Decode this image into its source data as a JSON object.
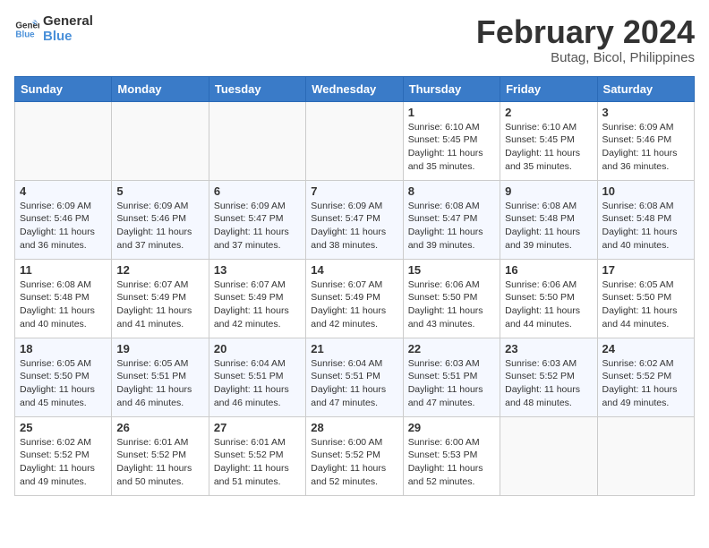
{
  "logo": {
    "text_general": "General",
    "text_blue": "Blue"
  },
  "header": {
    "title": "February 2024",
    "subtitle": "Butag, Bicol, Philippines"
  },
  "weekdays": [
    "Sunday",
    "Monday",
    "Tuesday",
    "Wednesday",
    "Thursday",
    "Friday",
    "Saturday"
  ],
  "weeks": [
    [
      {
        "day": "",
        "info": ""
      },
      {
        "day": "",
        "info": ""
      },
      {
        "day": "",
        "info": ""
      },
      {
        "day": "",
        "info": ""
      },
      {
        "day": "1",
        "info": "Sunrise: 6:10 AM\nSunset: 5:45 PM\nDaylight: 11 hours\nand 35 minutes."
      },
      {
        "day": "2",
        "info": "Sunrise: 6:10 AM\nSunset: 5:45 PM\nDaylight: 11 hours\nand 35 minutes."
      },
      {
        "day": "3",
        "info": "Sunrise: 6:09 AM\nSunset: 5:46 PM\nDaylight: 11 hours\nand 36 minutes."
      }
    ],
    [
      {
        "day": "4",
        "info": "Sunrise: 6:09 AM\nSunset: 5:46 PM\nDaylight: 11 hours\nand 36 minutes."
      },
      {
        "day": "5",
        "info": "Sunrise: 6:09 AM\nSunset: 5:46 PM\nDaylight: 11 hours\nand 37 minutes."
      },
      {
        "day": "6",
        "info": "Sunrise: 6:09 AM\nSunset: 5:47 PM\nDaylight: 11 hours\nand 37 minutes."
      },
      {
        "day": "7",
        "info": "Sunrise: 6:09 AM\nSunset: 5:47 PM\nDaylight: 11 hours\nand 38 minutes."
      },
      {
        "day": "8",
        "info": "Sunrise: 6:08 AM\nSunset: 5:47 PM\nDaylight: 11 hours\nand 39 minutes."
      },
      {
        "day": "9",
        "info": "Sunrise: 6:08 AM\nSunset: 5:48 PM\nDaylight: 11 hours\nand 39 minutes."
      },
      {
        "day": "10",
        "info": "Sunrise: 6:08 AM\nSunset: 5:48 PM\nDaylight: 11 hours\nand 40 minutes."
      }
    ],
    [
      {
        "day": "11",
        "info": "Sunrise: 6:08 AM\nSunset: 5:48 PM\nDaylight: 11 hours\nand 40 minutes."
      },
      {
        "day": "12",
        "info": "Sunrise: 6:07 AM\nSunset: 5:49 PM\nDaylight: 11 hours\nand 41 minutes."
      },
      {
        "day": "13",
        "info": "Sunrise: 6:07 AM\nSunset: 5:49 PM\nDaylight: 11 hours\nand 42 minutes."
      },
      {
        "day": "14",
        "info": "Sunrise: 6:07 AM\nSunset: 5:49 PM\nDaylight: 11 hours\nand 42 minutes."
      },
      {
        "day": "15",
        "info": "Sunrise: 6:06 AM\nSunset: 5:50 PM\nDaylight: 11 hours\nand 43 minutes."
      },
      {
        "day": "16",
        "info": "Sunrise: 6:06 AM\nSunset: 5:50 PM\nDaylight: 11 hours\nand 44 minutes."
      },
      {
        "day": "17",
        "info": "Sunrise: 6:05 AM\nSunset: 5:50 PM\nDaylight: 11 hours\nand 44 minutes."
      }
    ],
    [
      {
        "day": "18",
        "info": "Sunrise: 6:05 AM\nSunset: 5:50 PM\nDaylight: 11 hours\nand 45 minutes."
      },
      {
        "day": "19",
        "info": "Sunrise: 6:05 AM\nSunset: 5:51 PM\nDaylight: 11 hours\nand 46 minutes."
      },
      {
        "day": "20",
        "info": "Sunrise: 6:04 AM\nSunset: 5:51 PM\nDaylight: 11 hours\nand 46 minutes."
      },
      {
        "day": "21",
        "info": "Sunrise: 6:04 AM\nSunset: 5:51 PM\nDaylight: 11 hours\nand 47 minutes."
      },
      {
        "day": "22",
        "info": "Sunrise: 6:03 AM\nSunset: 5:51 PM\nDaylight: 11 hours\nand 47 minutes."
      },
      {
        "day": "23",
        "info": "Sunrise: 6:03 AM\nSunset: 5:52 PM\nDaylight: 11 hours\nand 48 minutes."
      },
      {
        "day": "24",
        "info": "Sunrise: 6:02 AM\nSunset: 5:52 PM\nDaylight: 11 hours\nand 49 minutes."
      }
    ],
    [
      {
        "day": "25",
        "info": "Sunrise: 6:02 AM\nSunset: 5:52 PM\nDaylight: 11 hours\nand 49 minutes."
      },
      {
        "day": "26",
        "info": "Sunrise: 6:01 AM\nSunset: 5:52 PM\nDaylight: 11 hours\nand 50 minutes."
      },
      {
        "day": "27",
        "info": "Sunrise: 6:01 AM\nSunset: 5:52 PM\nDaylight: 11 hours\nand 51 minutes."
      },
      {
        "day": "28",
        "info": "Sunrise: 6:00 AM\nSunset: 5:52 PM\nDaylight: 11 hours\nand 52 minutes."
      },
      {
        "day": "29",
        "info": "Sunrise: 6:00 AM\nSunset: 5:53 PM\nDaylight: 11 hours\nand 52 minutes."
      },
      {
        "day": "",
        "info": ""
      },
      {
        "day": "",
        "info": ""
      }
    ]
  ]
}
